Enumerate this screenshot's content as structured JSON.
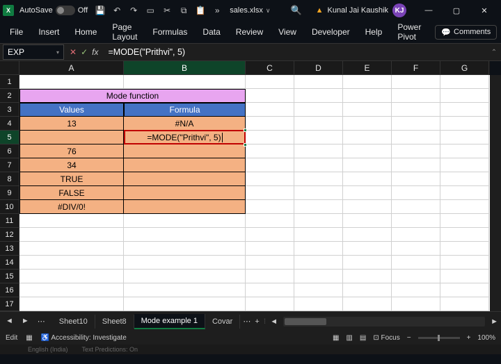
{
  "titlebar": {
    "autosave": "AutoSave",
    "off": "Off",
    "filename": "sales.xlsx",
    "user": "Kunal Jai Kaushik",
    "initials": "KJ"
  },
  "ribbon": {
    "file": "File",
    "insert": "Insert",
    "home": "Home",
    "pagelayout": "Page Layout",
    "formulas": "Formulas",
    "data": "Data",
    "review": "Review",
    "view": "View",
    "developer": "Developer",
    "help": "Help",
    "powerpivot": "Power Pivot",
    "comments": "Comments"
  },
  "formula": {
    "namebox": "EXP",
    "value": "=MODE(\"Prithvi\", 5)"
  },
  "columns": [
    "A",
    "B",
    "C",
    "D",
    "E",
    "F",
    "G"
  ],
  "rows": [
    "1",
    "2",
    "3",
    "4",
    "5",
    "6",
    "7",
    "8",
    "9",
    "10",
    "11",
    "12",
    "13",
    "14",
    "15",
    "16",
    "17"
  ],
  "data": {
    "merged_title": "Mode function",
    "a3": "Values",
    "b3": "Formula",
    "a4": "13",
    "b4": "#N/A",
    "b5": "=MODE(\"Prithvi\", 5)",
    "a6": "76",
    "a7": "34",
    "a8": "TRUE",
    "a9": "FALSE",
    "a10": "#DIV/0!"
  },
  "sheets": {
    "s1": "Sheet10",
    "s2": "Sheet8",
    "s3": "Mode example 1",
    "s4": "Covar"
  },
  "status": {
    "mode": "Edit",
    "access": "Accessibility: Investigate",
    "focus": "Focus",
    "zoom": "100%"
  },
  "cutoff": {
    "lang": "English (India)",
    "pred": "Text Predictions: On"
  }
}
